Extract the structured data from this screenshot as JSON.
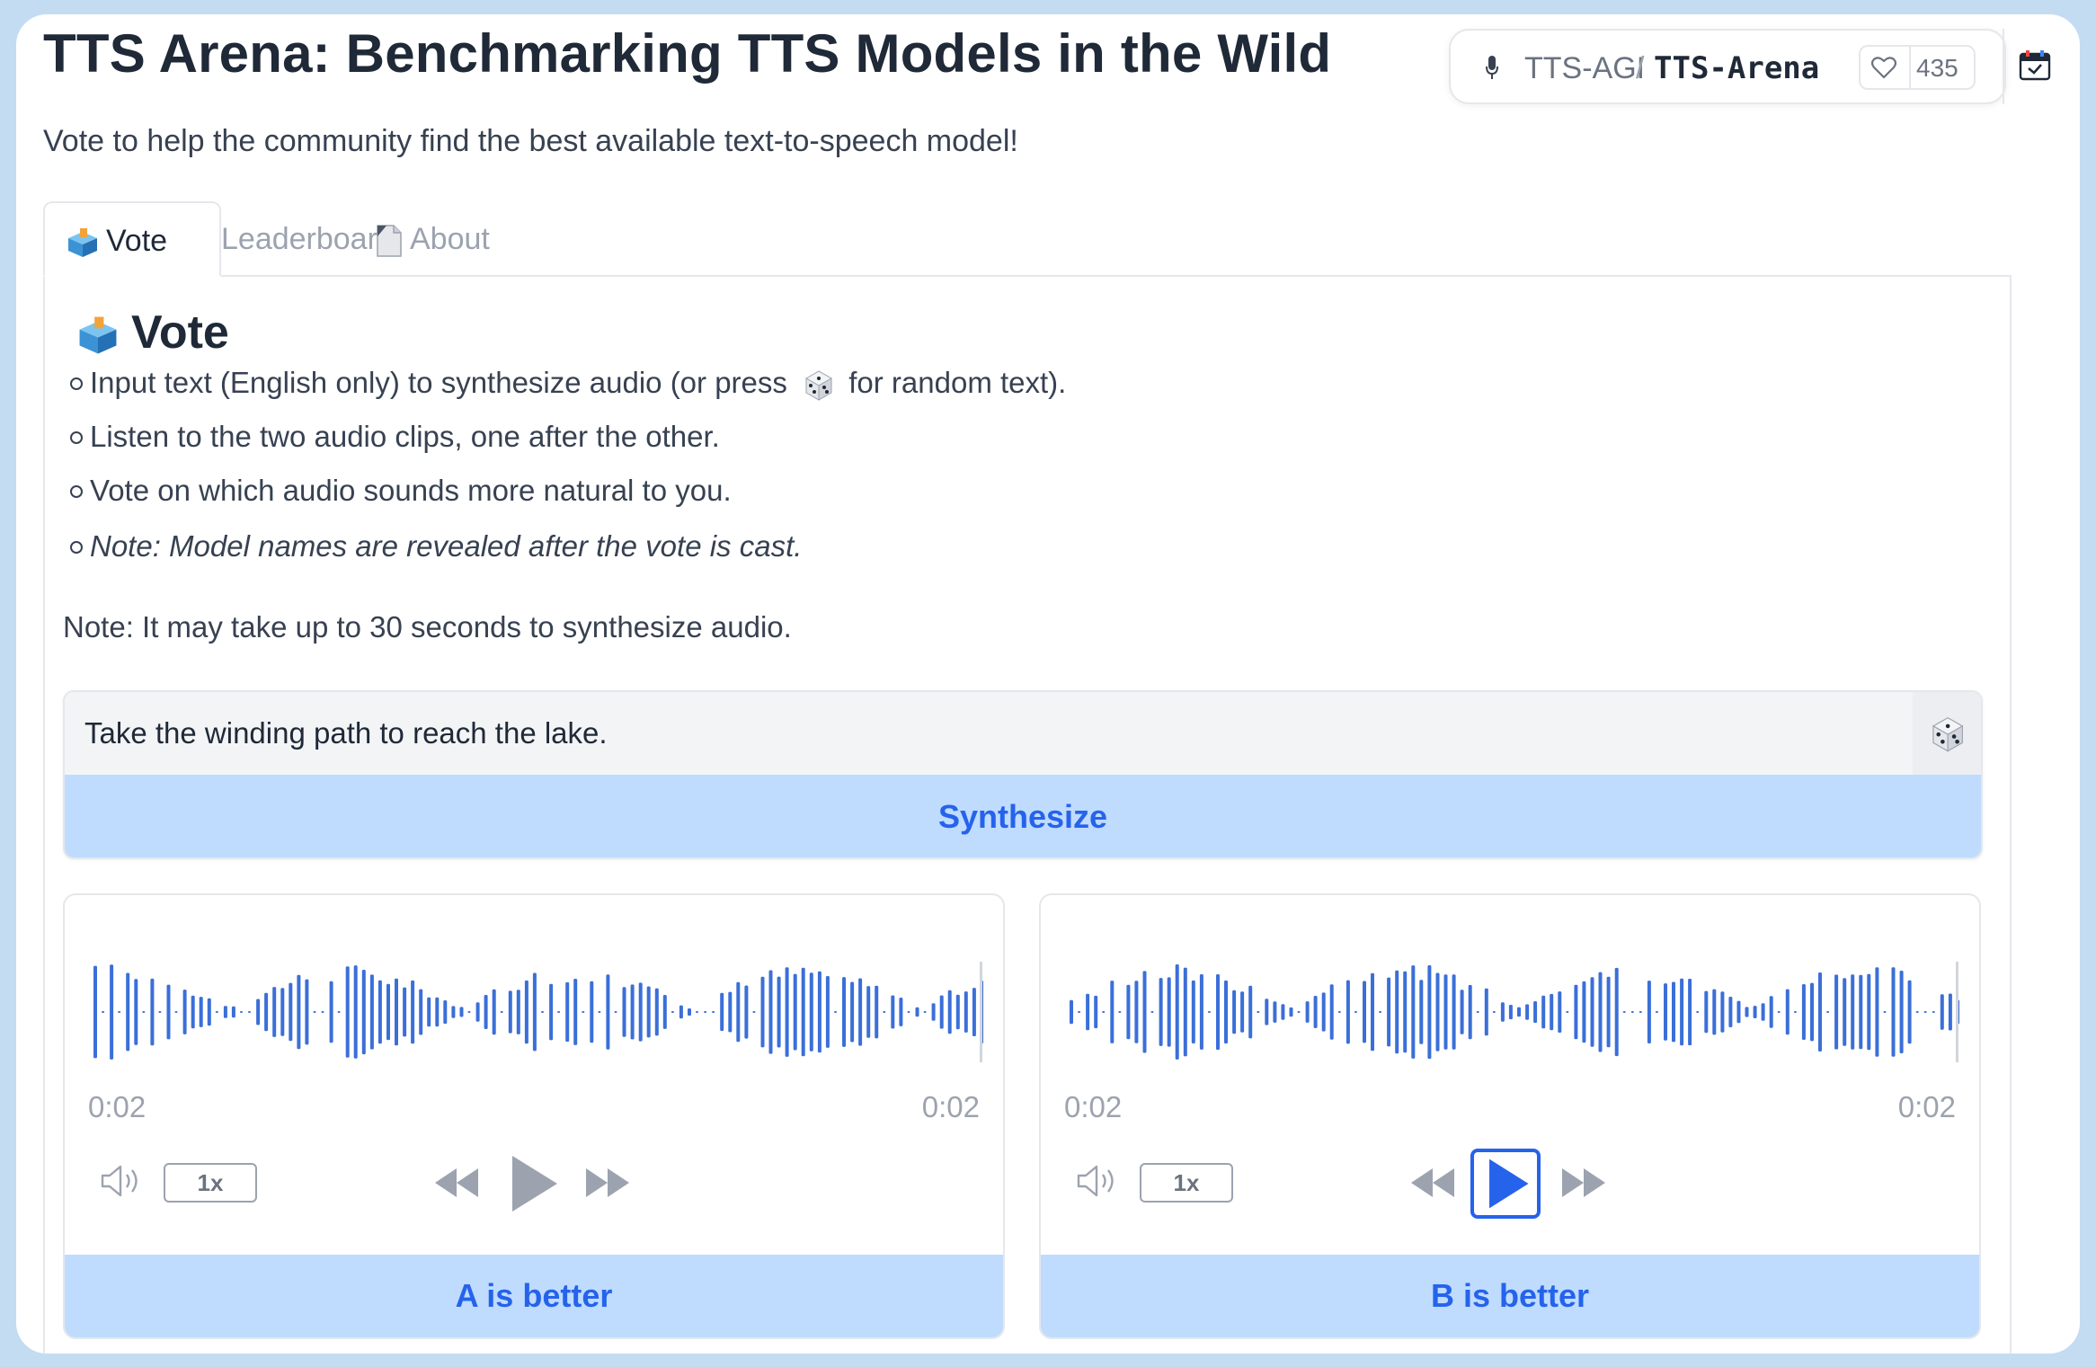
{
  "header": {
    "title": "TTS Arena: Benchmarking TTS Models in the Wild",
    "subtitle": "Vote to help the community find the best available text-to-speech model!"
  },
  "repo": {
    "org": "TTS-AGI",
    "separator": "/",
    "name": "TTS-Arena",
    "likes": "435",
    "icons": {
      "mic": "microphone-icon",
      "like": "heart-icon",
      "calendar": "calendar-icon"
    }
  },
  "tabs": [
    {
      "label": "Vote",
      "icon": "ballot-box-icon",
      "active": true
    },
    {
      "label": "Leaderboard",
      "icon": "trophy-icon",
      "active": false
    },
    {
      "label": "About",
      "icon": "page-icon",
      "active": false
    }
  ],
  "vote": {
    "heading": "Vote",
    "instructions": {
      "item1_before": "Input text (English only) to synthesize audio (or press",
      "item1_after": "for random text).",
      "item2": "Listen to the two audio clips, one after the other.",
      "item3": "Vote on which audio sounds more natural to you.",
      "item4": "Note: Model names are revealed after the vote is cast."
    },
    "note": "Note: It may take up to 30 seconds to synthesize audio.",
    "input_value": "Take the winding path to reach the lake.",
    "synthesize_label": "Synthesize"
  },
  "players": [
    {
      "id": "a",
      "time_current": "0:02",
      "time_total": "0:02",
      "rate": "1x",
      "vote_label": "A is better",
      "play_focused": false
    },
    {
      "id": "b",
      "time_current": "0:02",
      "time_total": "0:02",
      "rate": "1x",
      "vote_label": "B is better",
      "play_focused": true
    }
  ],
  "colors": {
    "accent": "#2563eb",
    "button_bg": "#bfdbfe",
    "waveform": "#3b6fd8",
    "frame": "#c4dcf2"
  }
}
